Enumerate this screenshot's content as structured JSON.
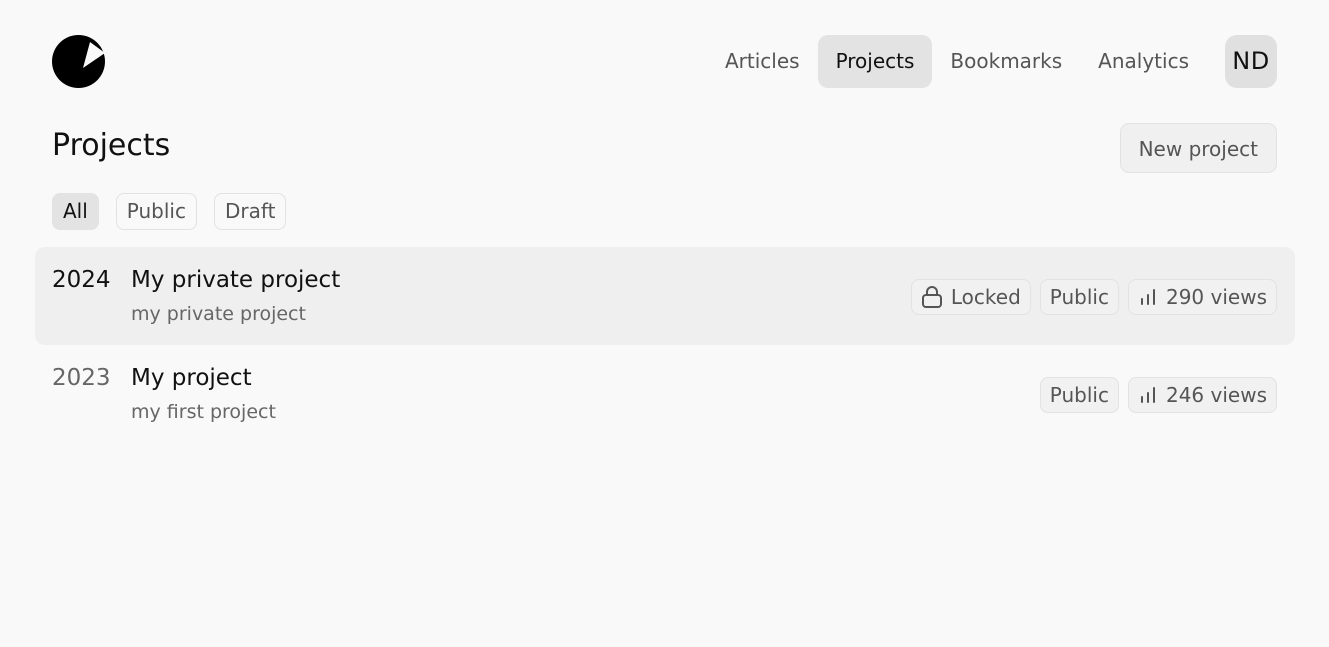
{
  "nav": {
    "items": [
      {
        "label": "Articles",
        "active": false
      },
      {
        "label": "Projects",
        "active": true
      },
      {
        "label": "Bookmarks",
        "active": false
      },
      {
        "label": "Analytics",
        "active": false
      }
    ],
    "avatar_initials": "ND"
  },
  "header": {
    "title": "Projects",
    "new_project_label": "New project"
  },
  "filters": [
    {
      "label": "All",
      "active": true
    },
    {
      "label": "Public",
      "active": false
    },
    {
      "label": "Draft",
      "active": false
    }
  ],
  "projects": [
    {
      "year": "2024",
      "title": "My private project",
      "description": "my private project",
      "locked_label": "Locked",
      "visibility": "Public",
      "views": "290 views",
      "icons": {
        "lock": "lock-icon",
        "views": "bar-chart-icon"
      }
    },
    {
      "year": "2023",
      "title": "My project",
      "description": "my first project",
      "visibility": "Public",
      "views": "246 views",
      "icons": {
        "views": "bar-chart-icon"
      }
    }
  ],
  "colors": {
    "background": "#f9f9f9",
    "active_bg": "#e3e3e3",
    "row_highlight": "#efefef",
    "text_primary": "#111111",
    "text_muted": "#555555"
  }
}
